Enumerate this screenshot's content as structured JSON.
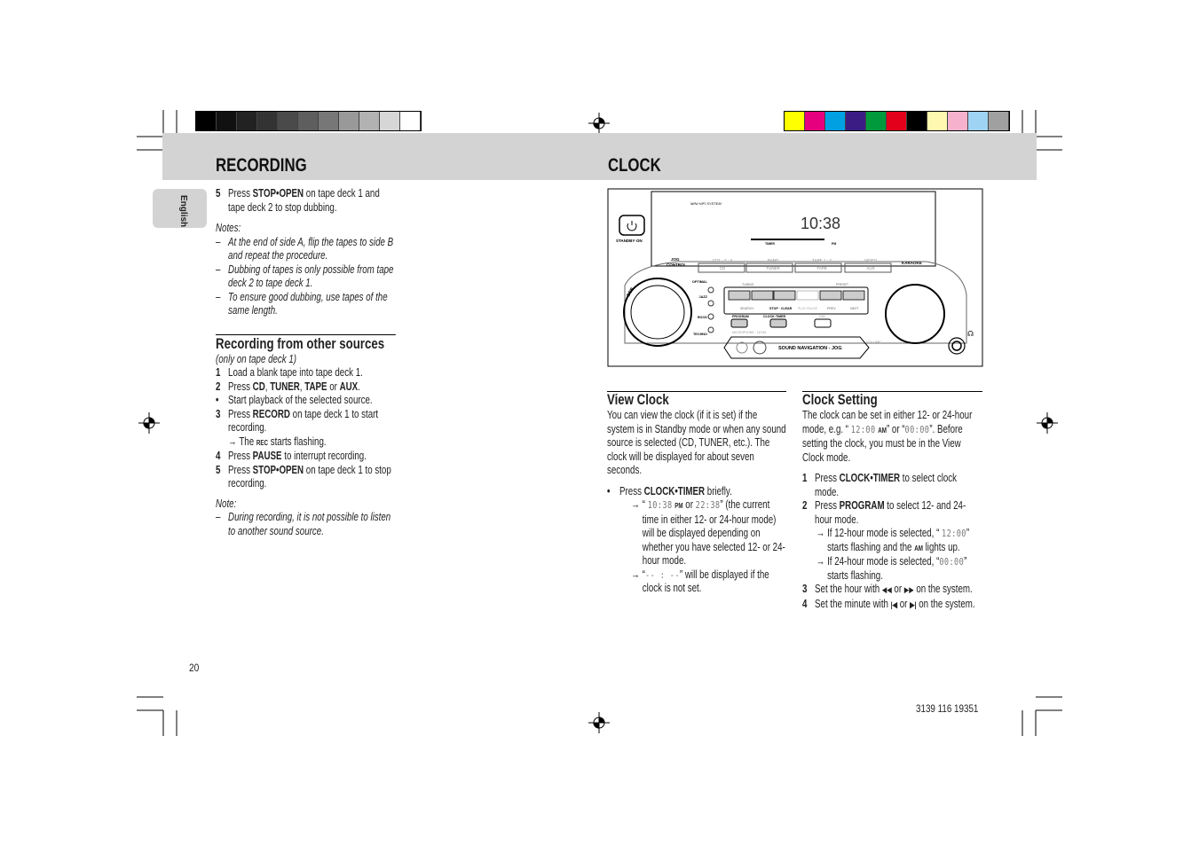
{
  "colors": {
    "header_band": "#d3d3d3",
    "grayscale_bar": [
      "#000000",
      "#111111",
      "#222222",
      "#333333",
      "#4a4a4a",
      "#5e5e5e",
      "#777777",
      "#999999",
      "#b2b2b2",
      "#d6d6d6",
      "#ffffff"
    ],
    "color_bar": [
      "#ffff00",
      "#e6007e",
      "#00a0e3",
      "#3b1c85",
      "#009a3d",
      "#e2001a",
      "#000000",
      "#fff8b0",
      "#f6b2cc",
      "#9fd3f3",
      "#a0a0a0"
    ]
  },
  "header": {
    "left_title": "RECORDING",
    "right_title": "CLOCK"
  },
  "language_tab": "English",
  "left": {
    "step5": {
      "num": "5",
      "a": "Press ",
      "b": "STOP•OPEN",
      "c": " on tape deck 1 and tape deck 2 to stop dubbing."
    },
    "notes_label": "Notes:",
    "notes": [
      "At the end of side A, flip the tapes to side B and repeat the procedure.",
      "Dubbing of tapes is only possible from tape deck 2 to tape deck 1.",
      "To ensure good dubbing, use tapes of the same length."
    ],
    "section_title": "Recording from other sources",
    "section_sub": "(only on tape deck 1)",
    "s1": {
      "num": "1",
      "text": "Load a blank tape into tape deck 1."
    },
    "s2": {
      "num": "2",
      "a": "Press ",
      "b1": "CD",
      "sep1": ", ",
      "b2": "TUNER",
      "sep2": ", ",
      "b3": "TAPE",
      "sep3": " or ",
      "b4": "AUX",
      "end": "."
    },
    "bullet": {
      "sym": "•",
      "text": "Start playback of the selected source."
    },
    "s3": {
      "num": "3",
      "a": "Press ",
      "b": "RECORD",
      "c": " on tape deck 1 to start recording."
    },
    "s3_result": {
      "arrow": "→",
      "a": "The ",
      "b": "REC",
      "c": " starts flashing."
    },
    "s4": {
      "num": "4",
      "a": "Press ",
      "b": "PAUSE",
      "c": " to interrupt recording."
    },
    "s5": {
      "num": "5",
      "a": "Press ",
      "b": "STOP•OPEN",
      "c": " on tape deck 1 to stop recording."
    },
    "note_label": "Note:",
    "note": "During recording, it is not possible to listen to another sound source."
  },
  "device": {
    "brand_text": "MINI HIFI SYSTEM",
    "display_time": "10:38",
    "display_labels": [
      "TIMER",
      "PM"
    ],
    "standby_label": "STANDBY·ON",
    "jog_label": [
      "JOG",
      "CONTROL"
    ],
    "dbb_label": "DBB",
    "source_top": [
      "CD1 · 2 · 3",
      "BAND",
      "TAPE 1 · 2",
      "VIDEO"
    ],
    "source_buttons": [
      "CD",
      "TUNER",
      "TAPE",
      "AUX"
    ],
    "karaoke_label": "KARAOKE",
    "eq_labels": [
      "OPTIMAL",
      "JAZZ",
      "ROCK",
      "TECHNO"
    ],
    "tuning_label": "TUNING",
    "preset_label": "PRESET",
    "transport_icons": [
      "rewind-icon",
      "fast-forward-icon",
      "stop-icon",
      "play-pause-icon",
      "previous-icon",
      "next-icon"
    ],
    "transport_labels": [
      "SEARCH",
      "STOP · CLEAR",
      "PLAY·PAUSE",
      "PREV",
      "NEXT"
    ],
    "program_label": "PROGRAM",
    "clock_timer_label": "CLOCK·TIMER",
    "dim_label": "DIM",
    "mic_label": "MICROPHONE · LEVEL",
    "sound_nav_label": "SOUND NAVIGATION - JOG",
    "volume_label": "VOLUME",
    "headphone_icon": "headphones-icon"
  },
  "view_clock": {
    "title": "View Clock",
    "intro": "You can view the clock (if it is set) if the system is in Standby mode or when any sound source is selected (CD, TUNER, etc.). The clock will be displayed for about seven seconds.",
    "bullet": {
      "sym": "•",
      "a": "Press ",
      "b": "CLOCK•TIMER",
      "c": " briefly."
    },
    "r1": {
      "arrow": "→",
      "q1": "“ ",
      "lcd1": "10:38",
      "pm": "PM",
      "or": " or ",
      "lcd2": "22:38",
      "rest": "” (the current time in either 12- or 24-hour mode) will be displayed depending on whether you have selected 12- or 24-hour mode."
    },
    "r2": {
      "arrow": "→",
      "q1": "“",
      "lcd": "-- : --",
      "rest": "” will be displayed if the clock is not set."
    }
  },
  "clock_setting": {
    "title": "Clock Setting",
    "intro_a": "The clock can be set in either 12- or 24-hour mode, e.g. “ ",
    "intro_lcd1": "12:00",
    "intro_am": "AM",
    "intro_b": "” or “",
    "intro_lcd2": "00:00",
    "intro_c": "”. Before setting the clock, you must be in the View Clock mode.",
    "s1": {
      "num": "1",
      "a": "Press ",
      "b": "CLOCK•TIMER",
      "c": " to select clock mode."
    },
    "s2": {
      "num": "2",
      "a": "Press ",
      "b": "PROGRAM",
      "c": " to select 12- and 24-hour mode."
    },
    "r1": {
      "arrow": "→",
      "a": "If 12-hour mode is selected, “ ",
      "lcd": "12:00",
      "b": "” starts flashing and the ",
      "am": "AM",
      "c": " lights up."
    },
    "r2": {
      "arrow": "→",
      "a": "If 24-hour mode is selected, “",
      "lcd": "00:00",
      "b": "” starts flashing."
    },
    "s3": {
      "num": "3",
      "a": "Set the hour with ",
      "i1": "◀◀",
      "or": " or ",
      "i2": "▶▶",
      "c": " on the system."
    },
    "s4": {
      "num": "4",
      "a": "Set the minute with  ",
      "i1": "|◀",
      "or": "  or  ",
      "i2": "▶|",
      "c": " on the system."
    }
  },
  "footer": {
    "page_number": "20",
    "doc_code": "3139 116 19351"
  }
}
